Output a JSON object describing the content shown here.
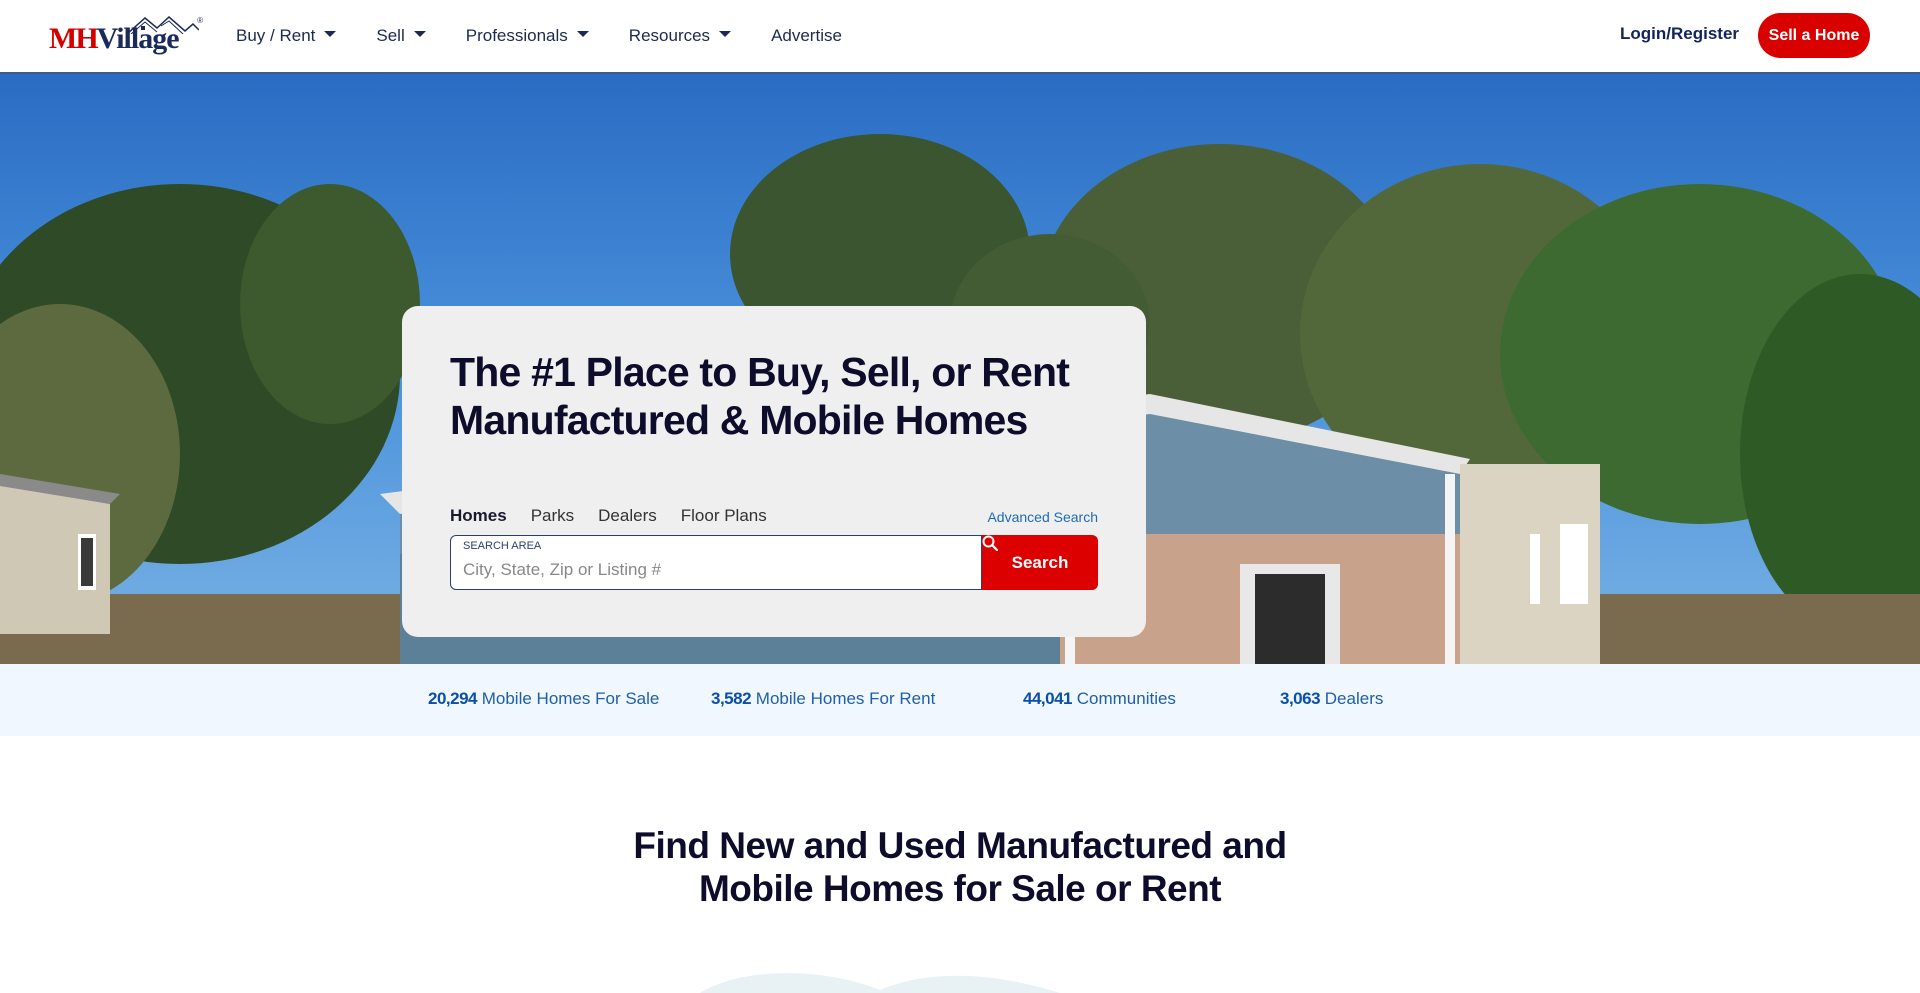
{
  "header": {
    "logo": {
      "part1": "MH",
      "part2": "Village",
      "reg": "®"
    },
    "nav": [
      {
        "label": "Buy / Rent",
        "has_dropdown": true
      },
      {
        "label": "Sell",
        "has_dropdown": true
      },
      {
        "label": "Professionals",
        "has_dropdown": true
      },
      {
        "label": "Resources",
        "has_dropdown": true
      },
      {
        "label": "Advertise",
        "has_dropdown": false
      }
    ],
    "login_label": "Login/Register",
    "sell_button_label": "Sell a Home"
  },
  "hero": {
    "title": "The #1 Place to Buy, Sell, or Rent Manufactured & Mobile Homes",
    "tabs": [
      {
        "label": "Homes",
        "active": true
      },
      {
        "label": "Parks",
        "active": false
      },
      {
        "label": "Dealers",
        "active": false
      },
      {
        "label": "Floor Plans",
        "active": false
      }
    ],
    "advanced_search_label": "Advanced Search",
    "search": {
      "label": "SEARCH AREA",
      "placeholder": "City, State, Zip or Listing #",
      "value": "",
      "button_label": "Search",
      "button_icon": "search-icon"
    }
  },
  "stats": [
    {
      "number": "20,294",
      "label": "Mobile Homes For Sale"
    },
    {
      "number": "3,582",
      "label": "Mobile Homes For Rent"
    },
    {
      "number": "44,041",
      "label": "Communities"
    },
    {
      "number": "3,063",
      "label": "Dealers"
    }
  ],
  "section": {
    "title_line1": "Find New and Used Manufactured and",
    "title_line2": "Mobile Homes for Sale or Rent"
  },
  "colors": {
    "brand_red": "#dc0000",
    "brand_navy": "#1b2a5c",
    "link_blue": "#1f6bb5",
    "stats_bg": "#f0f7fe"
  }
}
